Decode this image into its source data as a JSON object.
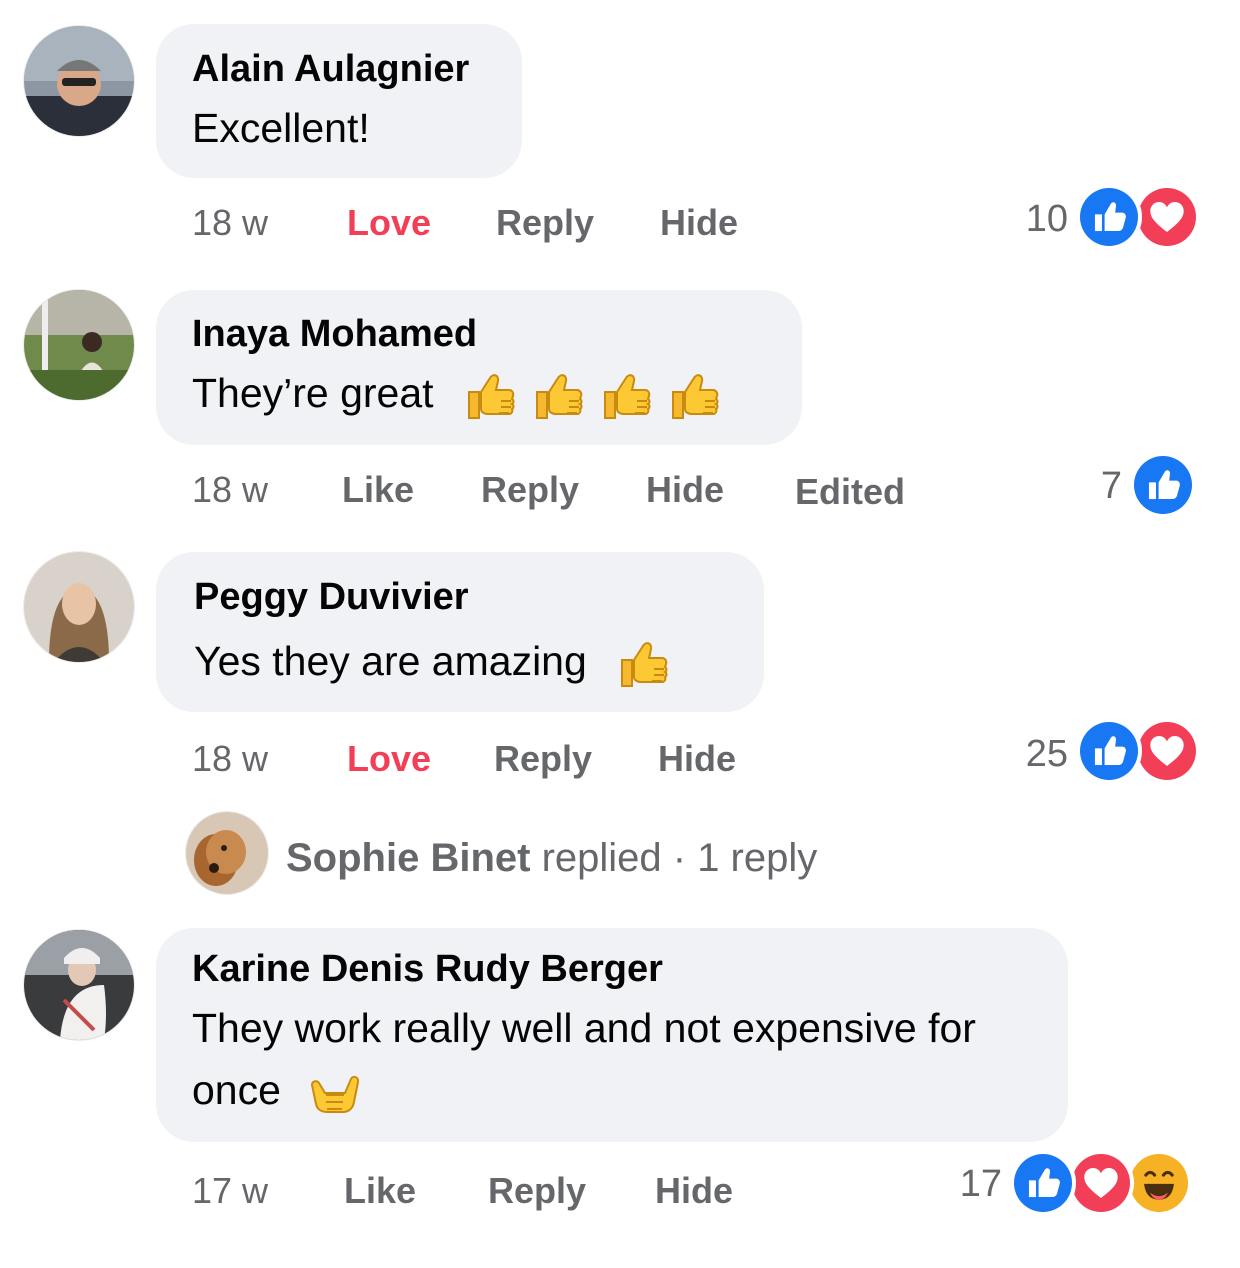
{
  "comments": [
    {
      "author": "Alain Aulagnier",
      "text": "Excellent!",
      "time": "18 w",
      "like_action": "Love",
      "reply_action": "Reply",
      "hide_action": "Hide",
      "reaction_count": "10",
      "reactions": [
        "like-reaction-icon",
        "love-reaction-icon"
      ]
    },
    {
      "author": "Inaya Mohamed",
      "text": "They’re great",
      "emojis": [
        "thumbs-up-emoji",
        "thumbs-up-emoji",
        "thumbs-up-emoji",
        "thumbs-up-emoji"
      ],
      "time": "18 w",
      "like_action": "Like",
      "reply_action": "Reply",
      "hide_action": "Hide",
      "edited_label": "Edited",
      "reaction_count": "7",
      "reactions": [
        "like-reaction-icon"
      ]
    },
    {
      "author": "Peggy Duvivier",
      "text": "Yes they are amazing",
      "emojis": [
        "thumbs-up-emoji"
      ],
      "time": "18 w",
      "like_action": "Love",
      "reply_action": "Reply",
      "hide_action": "Hide",
      "reaction_count": "25",
      "reactions": [
        "like-reaction-icon",
        "love-reaction-icon"
      ],
      "replies_summary": {
        "name": "Sophie Binet",
        "text": " replied · 1 reply"
      }
    },
    {
      "author": "Karine Denis Rudy Berger",
      "text": "They work really well and not expensive for once",
      "emojis": [
        "call-me-hand-emoji"
      ],
      "time": "17 w",
      "like_action": "Like",
      "reply_action": "Reply",
      "hide_action": "Hide",
      "reaction_count": "17",
      "reactions": [
        "like-reaction-icon",
        "love-reaction-icon",
        "haha-reaction-icon"
      ]
    }
  ],
  "colors": {
    "bubble": "#f0f2f5",
    "meta": "#65676b",
    "love": "#f33e58",
    "like_blue": "#1877f2"
  }
}
